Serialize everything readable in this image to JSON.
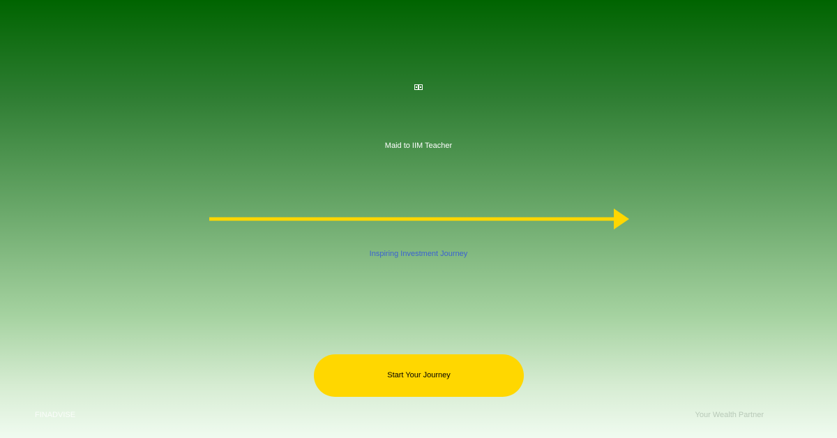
{
  "hero": {
    "icon_name": "money-icon",
    "headline": "Maid to IIM Teacher",
    "subtitle": "Inspiring Investment Journey",
    "cta_label": "Start Your Journey"
  },
  "footer": {
    "brand": "FINADVISE",
    "tagline": "Your Wealth Partner"
  },
  "colors": {
    "accent": "#FFD700",
    "subtitle": "#3B62D1",
    "bg_top": "#006400",
    "bg_bottom": "#F0FBF0"
  }
}
